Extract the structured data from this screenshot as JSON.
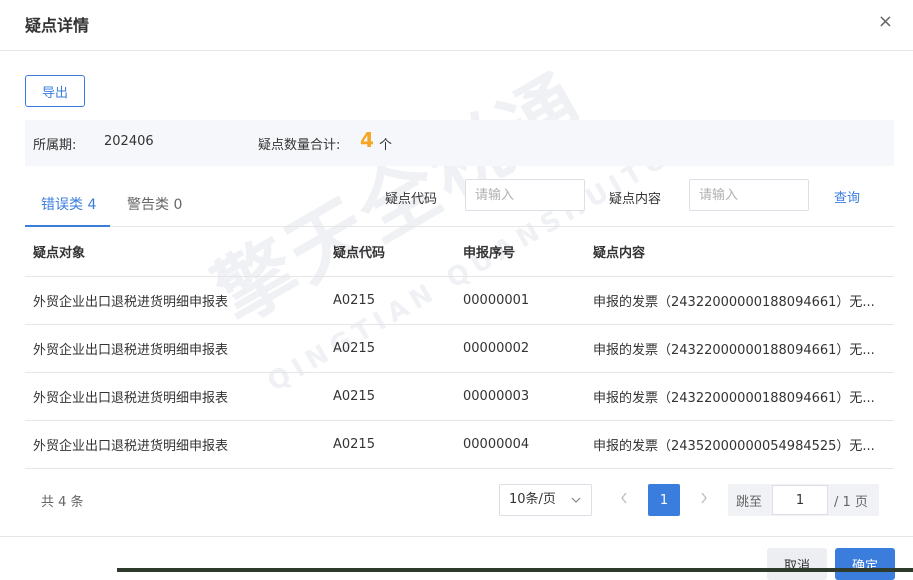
{
  "dialog": {
    "title": "疑点详情",
    "close_glyph": "×"
  },
  "toolbar": {
    "export_label": "导出"
  },
  "info": {
    "period_label": "所属期:",
    "period_value": "202406",
    "count_label": "疑点数量合计:",
    "count_value": "4",
    "count_unit": "个"
  },
  "tabs": [
    {
      "label": "错误类 4",
      "active": true
    },
    {
      "label": "警告类 0",
      "active": false
    }
  ],
  "filters": {
    "code_label": "疑点代码",
    "code_placeholder": "请输入",
    "content_label": "疑点内容",
    "content_placeholder": "请输入",
    "query_label": "查询"
  },
  "table": {
    "columns": [
      "疑点对象",
      "疑点代码",
      "申报序号",
      "疑点内容"
    ],
    "rows": [
      [
        "外贸企业出口退税进货明细申报表",
        "A0215",
        "00000001",
        "申报的发票（24322000000188094661）无..."
      ],
      [
        "外贸企业出口退税进货明细申报表",
        "A0215",
        "00000002",
        "申报的发票（24322000000188094661）无..."
      ],
      [
        "外贸企业出口退税进货明细申报表",
        "A0215",
        "00000003",
        "申报的发票（24322000000188094661）无..."
      ],
      [
        "外贸企业出口退税进货明细申报表",
        "A0215",
        "00000004",
        "申报的发票（24352000000054984525）无..."
      ]
    ]
  },
  "pagination": {
    "total_text": "共 4 条",
    "page_size": "10条/页",
    "current_page": "1",
    "jump_label": "跳至",
    "jump_value": "1",
    "total_pages_text": "/ 1 页"
  },
  "footer": {
    "cancel_label": "取消",
    "ok_label": "确定"
  },
  "watermark": {
    "main": "擎天全税通",
    "sub": "QINGTIAN QUANSHUITONG"
  },
  "colors": {
    "accent": "#3b7ddd",
    "count_highlight": "#f5a623"
  },
  "icons": {
    "close": "close-icon",
    "chevron_down": "chevron-down-icon",
    "prev": "chevron-left-icon",
    "next": "chevron-right-icon"
  }
}
